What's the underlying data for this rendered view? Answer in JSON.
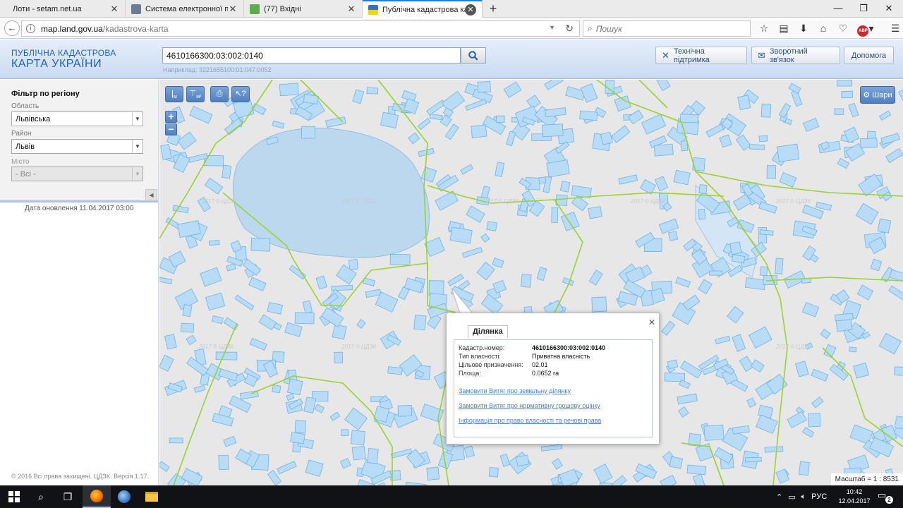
{
  "browser": {
    "tabs": [
      {
        "title": "Лоти - setam.net.ua",
        "favicon": "none"
      },
      {
        "title": "Система електронної по...",
        "favicon": "shield"
      },
      {
        "title": "(77) Вхідні",
        "favicon": "mail"
      },
      {
        "title": "Публічна кадастрова кар...",
        "favicon": "trident",
        "active": true
      }
    ],
    "url_host": "map.land.gov.ua",
    "url_path": "/kadastrova-karta",
    "search_placeholder": "Пошук"
  },
  "header": {
    "brand_line1": "ПУБЛІЧНА КАДАСТРОВА",
    "brand_line2": "КАРТА УКРАЇНИ",
    "search_value": "4610166300:03:002:0140",
    "search_example": "Наприклад: 3221655100:01:047:0052",
    "buttons": {
      "support": "Технічна підтримка",
      "feedback": "Зворотний зв'язок",
      "help": "Допомога"
    }
  },
  "sidebar": {
    "filter_title": "Фільтр по регіону",
    "region_label": "Область",
    "region_value": "Львівська",
    "district_label": "Район",
    "district_value": "Львів",
    "city_label": "Місто",
    "city_value": "- Всі -",
    "update_date": "Дата оновлення  11.04.2017 03:00",
    "copyright": "© 2016 Всі права захищені. ЦДЗК. Версія 1.17."
  },
  "map": {
    "layers_label": "Шари",
    "scale": "Масштаб = 1 : 8531",
    "watermark": "2017 © ЦДЗК",
    "tools": {
      "measure_m": "м",
      "measure_m2": "м²"
    },
    "colors": {
      "background": "#e7e7e7",
      "parcel_fill": "#b9dcf6",
      "parcel_stroke": "#6fb2e6",
      "boundary": "#9ad22e",
      "water": "#bcd8ee"
    }
  },
  "popup": {
    "tab_label": "Ділянка",
    "rows": [
      {
        "key": "Кадастр.номер:",
        "value": "4610166300:03:002:0140",
        "bold": true
      },
      {
        "key": "Тип власності:",
        "value": "Приватна власність"
      },
      {
        "key": "Цільове призначення:",
        "value": "02.01"
      },
      {
        "key": "Площа:",
        "value": "0.0652 га"
      }
    ],
    "links": [
      "Замовити Витяг про земельну ділянку",
      "Замовити Витяг про нормативну грошову оцінку",
      "Інформація про право власності та речові права"
    ]
  },
  "taskbar": {
    "language": "РУС",
    "time": "10:42",
    "date": "12.04.2017",
    "notifications": "2"
  }
}
